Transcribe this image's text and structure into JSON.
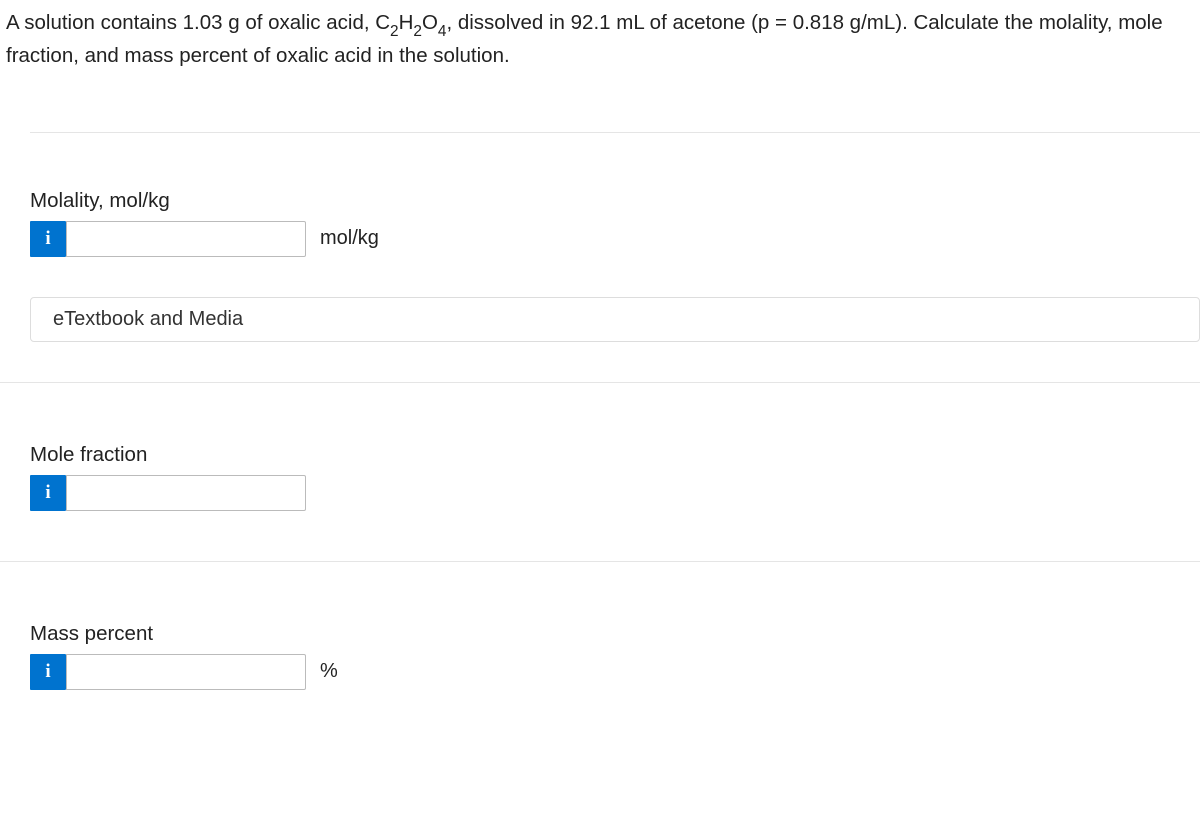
{
  "question": {
    "prefix": "A solution contains 1.03 g of oxalic acid, C",
    "sub1": "2",
    "mid1": "H",
    "sub2": "2",
    "mid2": "O",
    "sub3": "4",
    "suffix": ", dissolved in 92.1 mL of acetone (p = 0.818 g/mL). Calculate the molality, mole fraction, and mass percent of oxalic acid in the solution."
  },
  "sections": {
    "molality": {
      "label": "Molality, mol/kg",
      "unit": "mol/kg",
      "value": ""
    },
    "mole_fraction": {
      "label": "Mole fraction",
      "value": ""
    },
    "mass_percent": {
      "label": "Mass percent",
      "unit": "%",
      "value": ""
    }
  },
  "resource_button": "eTextbook and Media",
  "info_icon": "i"
}
